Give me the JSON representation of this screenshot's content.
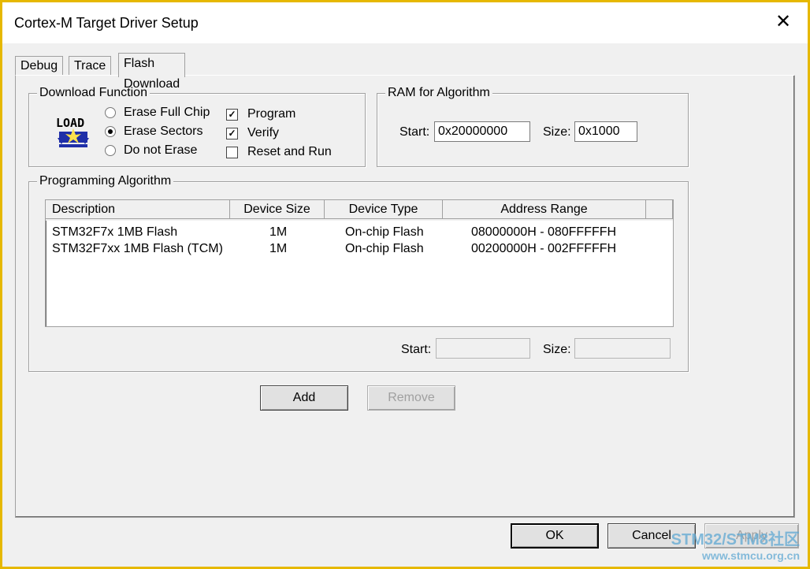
{
  "window": {
    "title": "Cortex-M Target Driver Setup",
    "close_glyph": "✕"
  },
  "tabs": [
    {
      "label": "Debug"
    },
    {
      "label": "Trace"
    },
    {
      "label": "Flash Download"
    }
  ],
  "download_function": {
    "legend": "Download Function",
    "icon_label": "LOAD",
    "radios": [
      {
        "label": "Erase Full Chip",
        "checked": false
      },
      {
        "label": "Erase Sectors",
        "checked": true
      },
      {
        "label": "Do not Erase",
        "checked": false
      }
    ],
    "checks": [
      {
        "label": "Program",
        "checked": true
      },
      {
        "label": "Verify",
        "checked": true
      },
      {
        "label": "Reset and Run",
        "checked": false
      }
    ]
  },
  "ram": {
    "legend": "RAM for Algorithm",
    "start_label": "Start:",
    "start_value": "0x20000000",
    "size_label": "Size:",
    "size_value": "0x1000"
  },
  "algorithm": {
    "legend": "Programming Algorithm",
    "columns": [
      "Description",
      "Device Size",
      "Device Type",
      "Address Range"
    ],
    "rows": [
      {
        "description": "STM32F7x 1MB Flash",
        "size": "1M",
        "type": "On-chip Flash",
        "range": "08000000H - 080FFFFFH"
      },
      {
        "description": "STM32F7xx 1MB Flash (TCM)",
        "size": "1M",
        "type": "On-chip Flash",
        "range": "00200000H - 002FFFFFH"
      }
    ],
    "start_label": "Start:",
    "start_value": "",
    "size_label": "Size:",
    "size_value": ""
  },
  "buttons": {
    "add": "Add",
    "remove": "Remove",
    "ok": "OK",
    "cancel": "Cancel",
    "apply": "Apply"
  },
  "watermark": {
    "line1": "STM32/STM8社区",
    "line2": "www.stmcu.org.cn"
  },
  "colors": {
    "window_border": "#e6b800",
    "watermark": "#5fa8d3"
  }
}
